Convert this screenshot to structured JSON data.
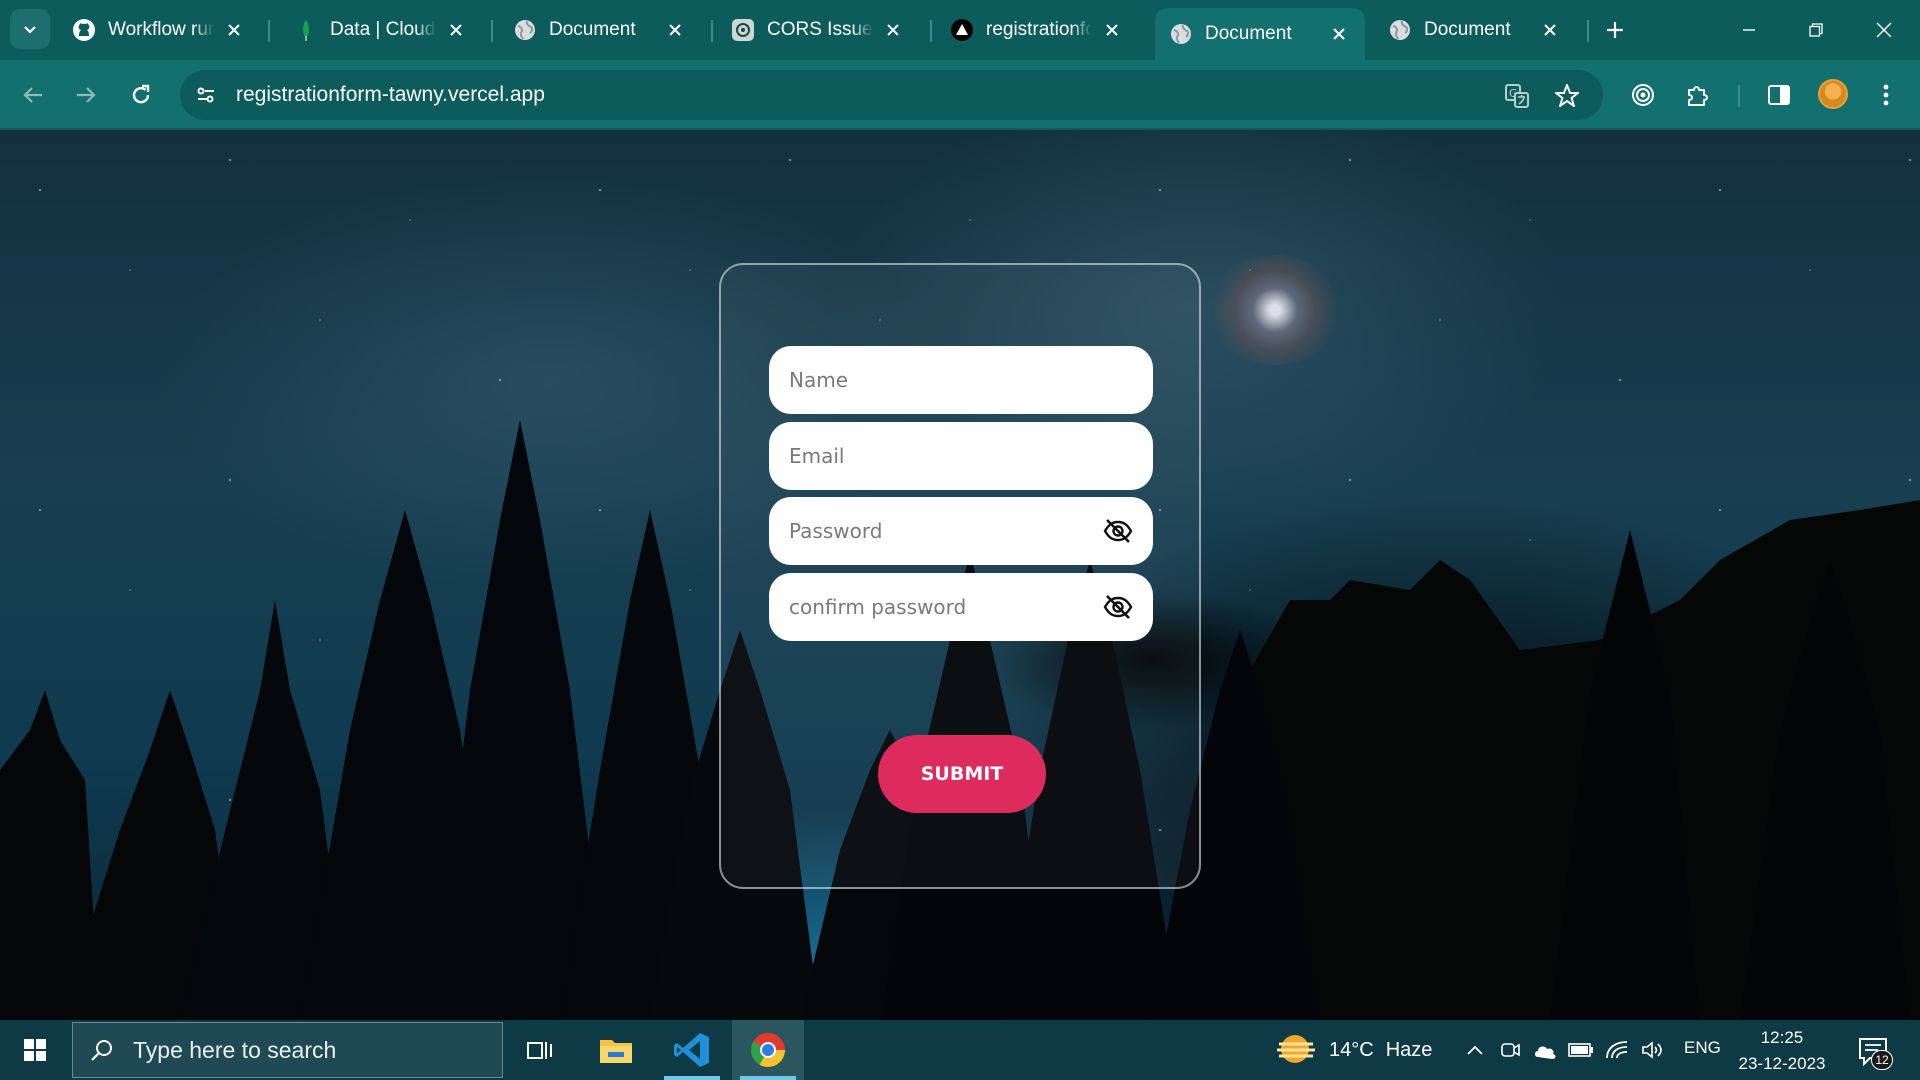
{
  "browser": {
    "tabs": [
      {
        "title": "Workflow runs",
        "favicon": "github-icon",
        "active": false
      },
      {
        "title": "Data | Cloud: MongoDB",
        "favicon": "mongodb-leaf-icon",
        "active": false
      },
      {
        "title": "Document",
        "favicon": "globe-icon",
        "active": false
      },
      {
        "title": "CORS Issue Resolution",
        "favicon": "chatgpt-icon",
        "active": false
      },
      {
        "title": "registrationform",
        "favicon": "vercel-icon",
        "active": false
      },
      {
        "title": "Document",
        "favicon": "globe-icon",
        "active": true
      },
      {
        "title": "Document",
        "favicon": "globe-icon",
        "active": false
      }
    ],
    "url": "registrationform-tawny.vercel.app",
    "theme_color": "#0c5c5c",
    "toolbar_icons": [
      "translate-icon",
      "bookmark-star-icon",
      "extension-record-icon",
      "extensions-puzzle-icon",
      "side-panel-icon",
      "profile-avatar",
      "more-menu-icon"
    ]
  },
  "form": {
    "fields": [
      {
        "placeholder": "Name",
        "type": "text",
        "has_eye": false
      },
      {
        "placeholder": "Email",
        "type": "email",
        "has_eye": false
      },
      {
        "placeholder": "Password",
        "type": "password",
        "has_eye": true
      },
      {
        "placeholder": "confirm password",
        "type": "password",
        "has_eye": true
      }
    ],
    "submit_label": "SUBMIT",
    "accent_color": "#dc2b5c"
  },
  "taskbar": {
    "search_placeholder": "Type here to search",
    "apps": [
      "task-view-icon",
      "file-explorer-icon",
      "vscode-icon",
      "chrome-icon"
    ],
    "weather": {
      "temp": "14°C",
      "condition": "Haze"
    },
    "language": "ENG",
    "time": "12:25",
    "date": "23-12-2023",
    "notification_count": "12"
  }
}
